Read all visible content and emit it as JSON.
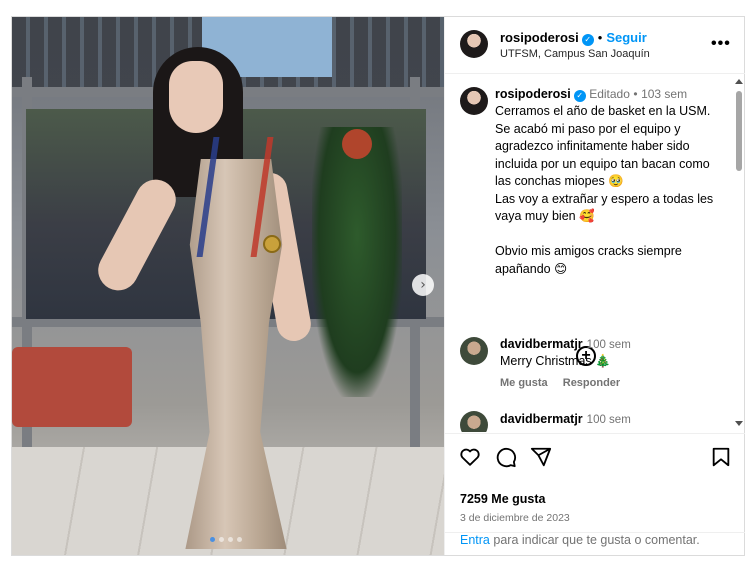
{
  "post": {
    "username": "rosipoderosi",
    "verified": true,
    "follow_label": "Seguir",
    "location": "UTFSM, Campus San Joaquín",
    "more_icon": "more-horizontal-icon",
    "media": {
      "slide_count": 4,
      "active_slide": 1
    }
  },
  "caption": {
    "username": "rosipoderosi",
    "edited_label": "Editado",
    "time": "103 sem",
    "text": "Cerramos el año de basket en la USM. Se acabó mi paso por el equipo y agradezco infinitamente haber sido incluida por un equipo tan bacan como las conchas miopes 🥹\nLas voy a extrañar y espero a todas les vaya muy bien 🥰\n\nObvio mis amigos cracks siempre apañando 😊"
  },
  "comments": [
    {
      "username": "davidbermatjr",
      "time": "100 sem",
      "text": "Merry Christmas 🎄",
      "like_label": "Me gusta",
      "reply_label": "Responder"
    },
    {
      "username": "davidbermatjr",
      "time": "100 sem",
      "text": ""
    }
  ],
  "actions": {
    "like_icon": "heart-icon",
    "comment_icon": "comment-icon",
    "share_icon": "share-icon",
    "save_icon": "bookmark-icon",
    "likes_text": "7259 Me gusta",
    "date": "3 de diciembre de 2023"
  },
  "login": {
    "link_label": "Entra",
    "text": "para indicar que te gusta o comentar."
  },
  "colors": {
    "accent": "#0095f6",
    "muted": "#737373",
    "border": "#dbdbdb"
  }
}
